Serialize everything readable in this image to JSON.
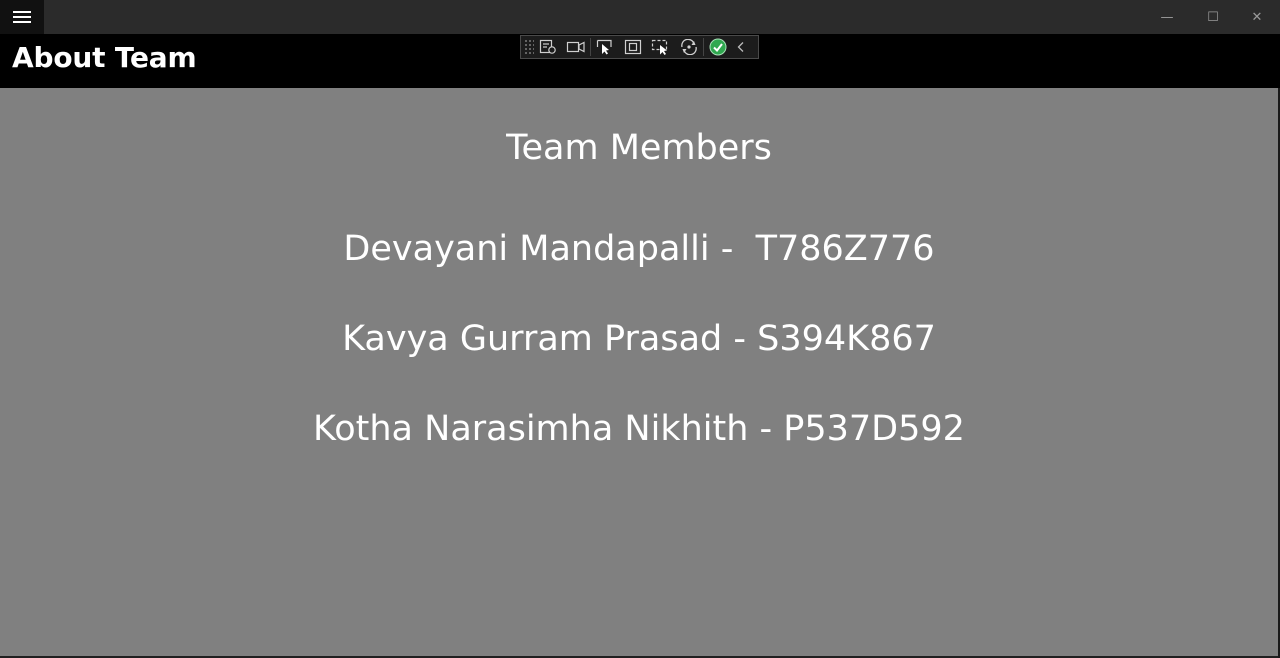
{
  "window": {
    "controls": {
      "minimize": "—",
      "maximize": "☐",
      "close": "✕"
    }
  },
  "header": {
    "title": "About Team"
  },
  "debug_toolbar": {
    "icons": [
      "live-visual-tree-icon",
      "record-icon",
      "select-element-icon",
      "display-layout-adorners-icon",
      "track-focus-icon",
      "hot-reload-icon",
      "hot-reload-status-check-icon",
      "collapse-chevron-icon"
    ]
  },
  "main": {
    "heading": "Team Members",
    "members": [
      {
        "text": "Devayani Mandapalli -  T786Z776"
      },
      {
        "text": "Kavya Gurram Prasad - S394K867"
      },
      {
        "text": "Kotha Narasimha Nikhith - P537D592"
      }
    ]
  },
  "colors": {
    "title_bar": "#2b2b2b",
    "header_bg": "#000000",
    "content_bg": "#808080",
    "text": "#ffffff",
    "status_ok": "#2fa84f"
  }
}
